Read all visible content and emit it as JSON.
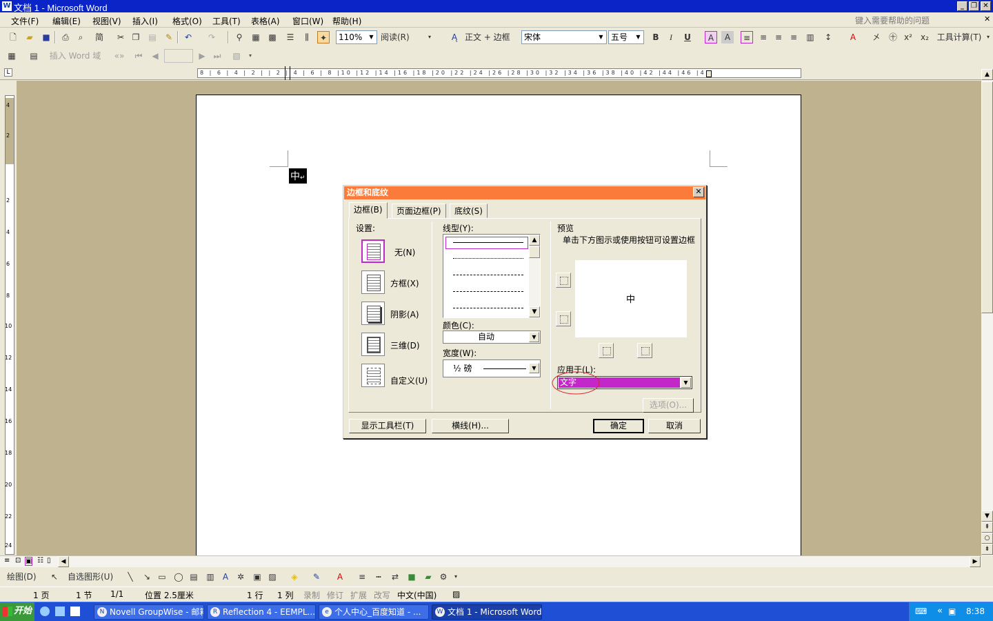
{
  "window": {
    "title": "文档 1 - Microsoft Word",
    "app_icon": "W",
    "min": "_",
    "restore": "❐",
    "close": "✕"
  },
  "menu": {
    "items": [
      "文件(F)",
      "编辑(E)",
      "视图(V)",
      "插入(I)",
      "格式(O)",
      "工具(T)",
      "表格(A)",
      "窗口(W)",
      "帮助(H)"
    ],
    "help_placeholder": "键入需要帮助的问题",
    "doc_close": "✕"
  },
  "toolbar": {
    "zoom": "110%",
    "read_label": "阅读(R)",
    "style": "正文 + 边框",
    "font": "宋体",
    "size": "五号",
    "bold": "B",
    "italic": "I",
    "underline": "U",
    "tools_calc": "工具计算(T)",
    "jian": "简",
    "char_a": "A"
  },
  "toolbar2": {
    "insert_word_field": "插入 Word 域"
  },
  "ruler": {
    "h_ticks": "8 | 6 | 4 | 2 | | 2 | 4 | 6 | 8 |10 |12 |14 |16 |18 |20 |22 |24 |26 |28 |30 |32 |34 |36 |38 |40 |42 |44 |46 |48",
    "v_ticks": [
      "4",
      "2",
      "2",
      "4",
      "6",
      "8",
      "10",
      "12",
      "14",
      "16",
      "18",
      "20",
      "22",
      "24"
    ],
    "corner": "L"
  },
  "document": {
    "selected_char": "中",
    "paragraph_mark": "↵"
  },
  "dialog": {
    "title": "边框和底纹",
    "close": "✕",
    "tabs": [
      "边框(B)",
      "页面边框(P)",
      "底纹(S)"
    ],
    "settings_label": "设置:",
    "settings": [
      "无(N)",
      "方框(X)",
      "阴影(A)",
      "三维(D)",
      "自定义(U)"
    ],
    "linestyle_label": "线型(Y):",
    "color_label": "颜色(C):",
    "color_value": "自动",
    "width_label": "宽度(W):",
    "width_value": "½ 磅",
    "preview_label": "预览",
    "preview_hint": "单击下方图示或使用按钮可设置边框",
    "preview_char": "中",
    "apply_label": "应用于(L):",
    "apply_value": "文字",
    "options_button": "选项(O)...",
    "show_toolbar_button": "显示工具栏(T)",
    "horizontal_line_button": "横线(H)...",
    "ok_button": "确定",
    "cancel_button": "取消"
  },
  "drawbar": {
    "draw": "绘图(D)",
    "autoshapes": "自选图形(U)"
  },
  "status": {
    "page": "1 页",
    "section": "1 节",
    "pages": "1/1",
    "position": "位置 2.5厘米",
    "line": "1 行",
    "col": "1 列",
    "rec": "录制",
    "trk": "修订",
    "ext": "扩展",
    "ovr": "改写",
    "lang": "中文(中国)"
  },
  "taskbar": {
    "start": "开始",
    "tasks": [
      "Novell GroupWise - 邮箱",
      "Reflection 4 - EEMPL....",
      "个人中心_百度知道 - ...",
      "文档 1 - Microsoft Word"
    ],
    "clock": "8:38",
    "tray_expand": "«"
  },
  "colors": {
    "title_blue": "#0a24c8",
    "dialog_title": "#fa7b3a",
    "apply_highlight": "#c427c9",
    "annotation": "#d9232e"
  }
}
